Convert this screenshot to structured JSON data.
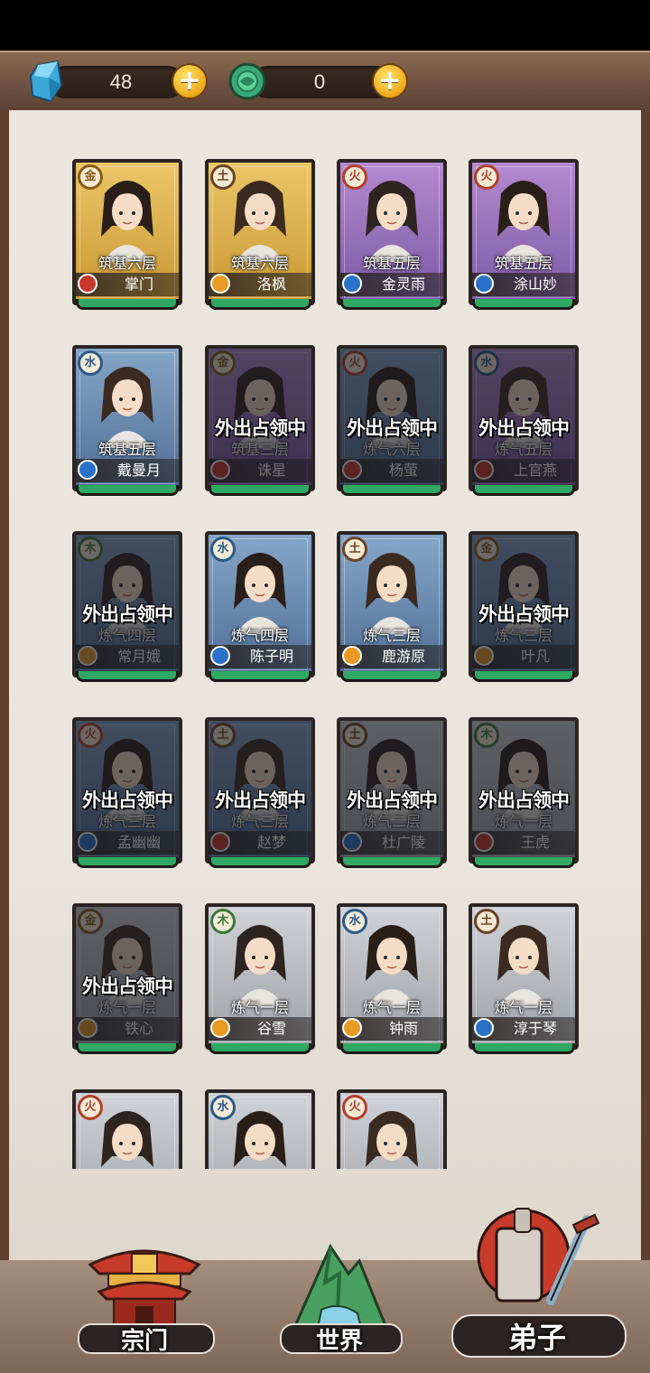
{
  "resources": [
    {
      "icon": "spirit-crystal-icon",
      "value": "48"
    },
    {
      "icon": "jade-coin-icon",
      "value": "0"
    }
  ],
  "cards": [
    {
      "element": "金",
      "rank": "筑基六层",
      "name": "掌门",
      "bg": "gold",
      "role": "red",
      "away_text": ""
    },
    {
      "element": "土",
      "rank": "筑基六层",
      "name": "洛枫",
      "bg": "gold",
      "role": "gold",
      "away_text": ""
    },
    {
      "element": "火",
      "rank": "筑基五层",
      "name": "金灵雨",
      "bg": "purple",
      "role": "blue",
      "away_text": ""
    },
    {
      "element": "火",
      "rank": "筑基五层",
      "name": "涂山妙",
      "bg": "purple",
      "role": "blue",
      "away_text": ""
    },
    {
      "element": "水",
      "rank": "筑基五层",
      "name": "戴曼月",
      "bg": "blue",
      "role": "blue",
      "away_text": ""
    },
    {
      "element": "金",
      "rank": "筑基三层",
      "name": "诛星",
      "bg": "purple",
      "role": "red",
      "away_text": "外出占领中"
    },
    {
      "element": "火",
      "rank": "炼气六层",
      "name": "杨萤",
      "bg": "blue",
      "role": "red",
      "away_text": "外出占领中"
    },
    {
      "element": "水",
      "rank": "炼气五层",
      "name": "上官燕",
      "bg": "purple",
      "role": "red",
      "away_text": "外出占领中"
    },
    {
      "element": "木",
      "rank": "炼气四层",
      "name": "常月娥",
      "bg": "blue",
      "role": "gold",
      "away_text": "外出占领中"
    },
    {
      "element": "水",
      "rank": "炼气四层",
      "name": "陈子明",
      "bg": "blue",
      "role": "blue",
      "away_text": ""
    },
    {
      "element": "土",
      "rank": "炼气三层",
      "name": "鹿游原",
      "bg": "blue",
      "role": "gold",
      "away_text": ""
    },
    {
      "element": "金",
      "rank": "炼气三层",
      "name": "叶凡",
      "bg": "blue",
      "role": "gold",
      "away_text": "外出占领中"
    },
    {
      "element": "火",
      "rank": "炼气三层",
      "name": "孟幽幽",
      "bg": "blue",
      "role": "blue",
      "away_text": "外出占领中"
    },
    {
      "element": "土",
      "rank": "炼气三层",
      "name": "赵梦",
      "bg": "blue",
      "role": "red",
      "away_text": "外出占领中"
    },
    {
      "element": "土",
      "rank": "炼气二层",
      "name": "杜广陵",
      "bg": "gray",
      "role": "blue",
      "away_text": "外出占领中"
    },
    {
      "element": "木",
      "rank": "炼气一层",
      "name": "王虎",
      "bg": "gray",
      "role": "red",
      "away_text": "外出占领中"
    },
    {
      "element": "金",
      "rank": "炼气一层",
      "name": "铁心",
      "bg": "gray",
      "role": "gold",
      "away_text": "外出占领中"
    },
    {
      "element": "木",
      "rank": "炼气一层",
      "name": "谷雪",
      "bg": "gray",
      "role": "gold",
      "away_text": ""
    },
    {
      "element": "水",
      "rank": "炼气一层",
      "name": "钟雨",
      "bg": "gray",
      "role": "gold",
      "away_text": ""
    },
    {
      "element": "土",
      "rank": "炼气一层",
      "name": "淳于琴",
      "bg": "gray",
      "role": "blue",
      "away_text": ""
    },
    {
      "element": "火",
      "rank": "",
      "name": "",
      "bg": "gray",
      "role": "",
      "away_text": ""
    },
    {
      "element": "水",
      "rank": "",
      "name": "",
      "bg": "gray",
      "role": "",
      "away_text": ""
    },
    {
      "element": "火",
      "rank": "",
      "name": "",
      "bg": "gray",
      "role": "",
      "away_text": ""
    }
  ],
  "nav": {
    "sect_label": "宗门",
    "world_label": "世界",
    "disciples_label": "弟子"
  }
}
